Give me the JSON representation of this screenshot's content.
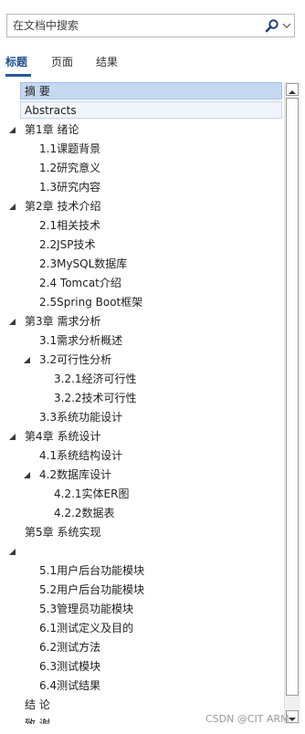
{
  "search": {
    "placeholder": "在文档中搜索"
  },
  "tabs": [
    {
      "label": "标题",
      "active": true
    },
    {
      "label": "页面",
      "active": false
    },
    {
      "label": "结果",
      "active": false
    }
  ],
  "tree": [
    {
      "label": "摘  要",
      "level": 1,
      "state": "selected"
    },
    {
      "label": "Abstracts",
      "level": 1,
      "state": "hover"
    },
    {
      "label": "第1章 绪论",
      "level": 1,
      "expanded": true
    },
    {
      "label": "1.1课题背景",
      "level": 2
    },
    {
      "label": "1.2研究意义",
      "level": 2
    },
    {
      "label": "1.3研究内容",
      "level": 2
    },
    {
      "label": "第2章 技术介绍",
      "level": 1,
      "expanded": true
    },
    {
      "label": "2.1相关技术",
      "level": 2
    },
    {
      "label": "2.2JSP技术",
      "level": 2
    },
    {
      "label": "2.3MySQL数据库",
      "level": 2
    },
    {
      "label": "2.4 Tomcat介绍",
      "level": 2
    },
    {
      "label": "2.5Spring Boot框架",
      "level": 2
    },
    {
      "label": "第3章 需求分析",
      "level": 1,
      "expanded": true
    },
    {
      "label": "3.1需求分析概述",
      "level": 2
    },
    {
      "label": "3.2可行性分析",
      "level": 2,
      "expanded": true
    },
    {
      "label": "3.2.1经济可行性",
      "level": 3
    },
    {
      "label": "3.2.2技术可行性",
      "level": 3
    },
    {
      "label": "3.3系统功能设计",
      "level": 2
    },
    {
      "label": "第4章 系统设计",
      "level": 1,
      "expanded": true
    },
    {
      "label": "4.1系统结构设计",
      "level": 2
    },
    {
      "label": "4.2数据库设计",
      "level": 2,
      "expanded": true
    },
    {
      "label": "4.2.1实体ER图",
      "level": 3
    },
    {
      "label": "4.2.2数据表",
      "level": 3
    },
    {
      "label": "第5章 系统实现",
      "level": 1
    },
    {
      "label": "",
      "level": 1,
      "expanded": true
    },
    {
      "label": "5.1用户后台功能模块",
      "level": 2
    },
    {
      "label": "5.2用户后台功能模块",
      "level": 2
    },
    {
      "label": "5.3管理员功能模块",
      "level": 2
    },
    {
      "label": "6.1测试定义及目的",
      "level": 2
    },
    {
      "label": "6.2测试方法",
      "level": 2
    },
    {
      "label": "6.3测试模块",
      "level": 2
    },
    {
      "label": "6.4测试结果",
      "level": 2
    },
    {
      "label": "结  论",
      "level": 1
    },
    {
      "label": "致  谢",
      "level": 1
    }
  ],
  "watermark": "CSDN @CIT ARM"
}
